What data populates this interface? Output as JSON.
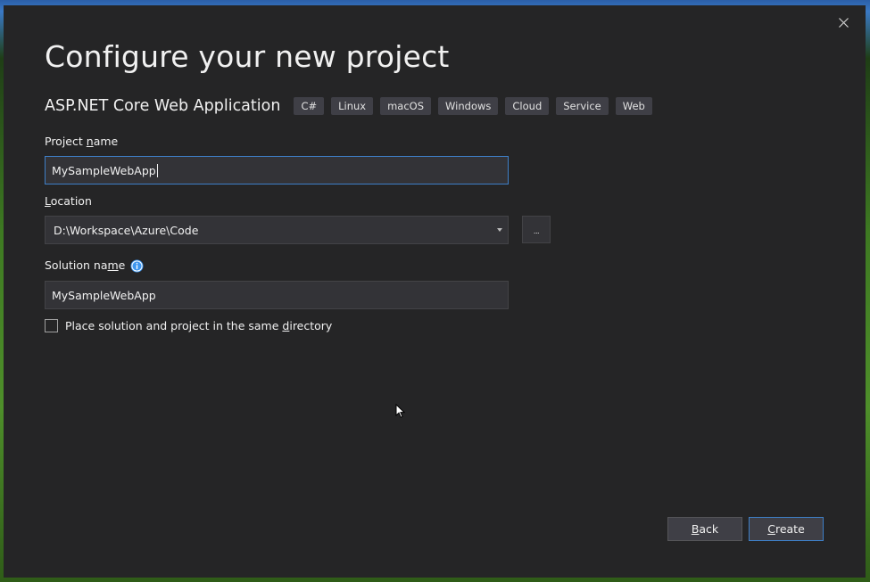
{
  "dialog": {
    "title": "Configure your new project",
    "template_name": "ASP.NET Core Web Application",
    "tags": [
      "C#",
      "Linux",
      "macOS",
      "Windows",
      "Cloud",
      "Service",
      "Web"
    ]
  },
  "project_name": {
    "label_pre": "Project ",
    "label_access": "n",
    "label_post": "ame",
    "value": "MySampleWebApp"
  },
  "location": {
    "label_access": "L",
    "label_post": "ocation",
    "value": "D:\\Workspace\\Azure\\Code",
    "browse_label": "..."
  },
  "solution_name": {
    "label_pre": "Solution na",
    "label_access": "m",
    "label_post": "e",
    "value": "MySampleWebApp"
  },
  "same_directory": {
    "label_pre": "Place solution and project in the same ",
    "label_access": "d",
    "label_post": "irectory",
    "checked": false
  },
  "buttons": {
    "back_access": "B",
    "back_post": "ack",
    "create_access": "C",
    "create_post": "reate"
  },
  "colors": {
    "dialog_bg": "#252526",
    "accent": "#3e7fc7",
    "info_icon": "#3e97f0"
  },
  "icons": {
    "close": "close-icon",
    "info": "info-icon",
    "dropdown": "chevron-down-icon",
    "cursor": "mouse-pointer-icon"
  }
}
